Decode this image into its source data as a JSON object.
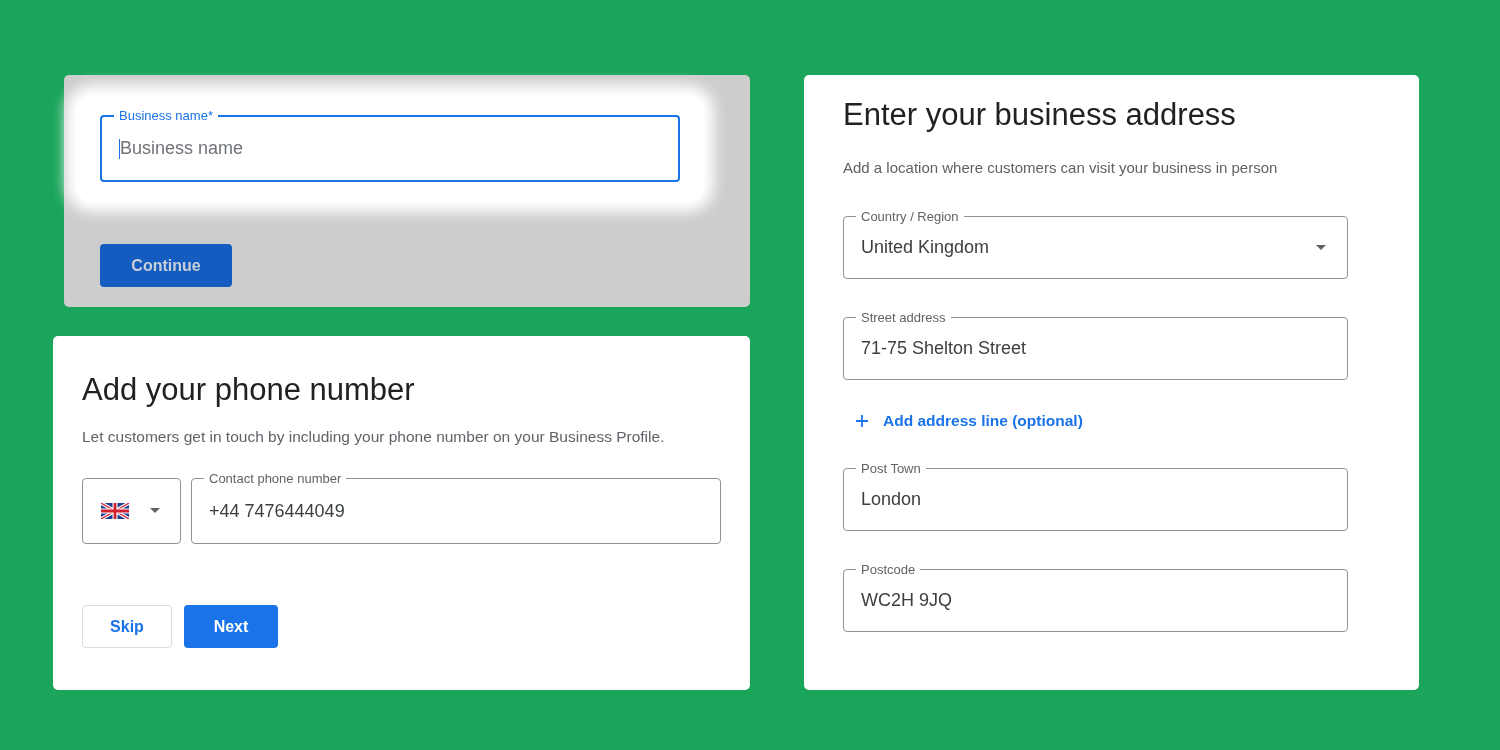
{
  "business_name_card": {
    "dimmed": true,
    "field": {
      "label": "Business name*",
      "placeholder": "Business name",
      "focused": true
    },
    "button": "Continue"
  },
  "phone_card": {
    "title": "Add your phone number",
    "description": "Let customers get in touch by including your phone number on your Business Profile.",
    "phone_field": {
      "label": "Contact phone number",
      "value": "+44 7476444049"
    },
    "buttons": [
      {
        "label": "Skip",
        "kind": "secondary"
      },
      {
        "label": "Next",
        "kind": "primary"
      }
    ]
  },
  "address_card": {
    "title": "Enter your business address",
    "description": "Add a location where customers can visit your business in person",
    "fields": [
      {
        "kind": "select",
        "label": "Country / Region",
        "value": "United Kingdom"
      },
      {
        "kind": "text",
        "label": "Street address",
        "value": "71-75 Shelton Street"
      },
      {
        "kind": "link",
        "label": "Add address line (optional)"
      },
      {
        "kind": "text",
        "label": "Post Town",
        "value": "London"
      },
      {
        "kind": "text",
        "label": "Postcode",
        "value": "WC2H 9JQ"
      }
    ]
  }
}
